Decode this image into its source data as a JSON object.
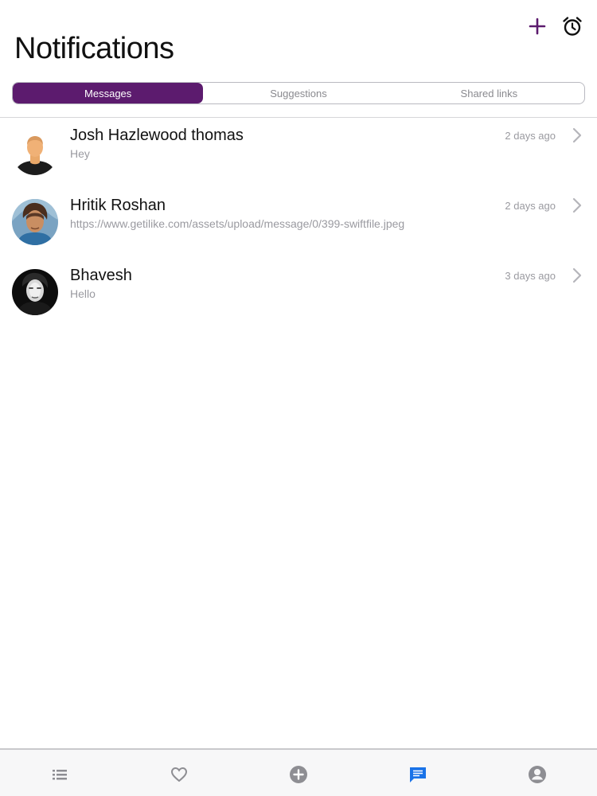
{
  "header": {
    "title": "Notifications",
    "add_icon": "plus-icon",
    "alarm_icon": "alarm-clock-icon"
  },
  "segments": {
    "items": [
      "Messages",
      "Suggestions",
      "Shared links"
    ],
    "selected": "Messages"
  },
  "messages": [
    {
      "name": "Josh Hazlewood thomas",
      "preview": "Hey",
      "time": "2 days ago",
      "avatar": "default-person-avatar"
    },
    {
      "name": "Hritik Roshan",
      "preview": "https://www.getilike.com/assets/upload/message/0/399-swiftfile.jpeg",
      "time": "2 days ago",
      "avatar": "photo-avatar"
    },
    {
      "name": "Bhavesh",
      "preview": "Hello",
      "time": "3 days ago",
      "avatar": "photo-avatar"
    }
  ],
  "tabbar": {
    "items": [
      "list-icon",
      "heart-icon",
      "plus-circle-icon",
      "chat-icon",
      "profile-icon"
    ],
    "active": "chat-icon"
  },
  "colors": {
    "accent": "#5c1b6e",
    "active_tab": "#1a73e8",
    "inactive_tab": "#8e8e93"
  }
}
